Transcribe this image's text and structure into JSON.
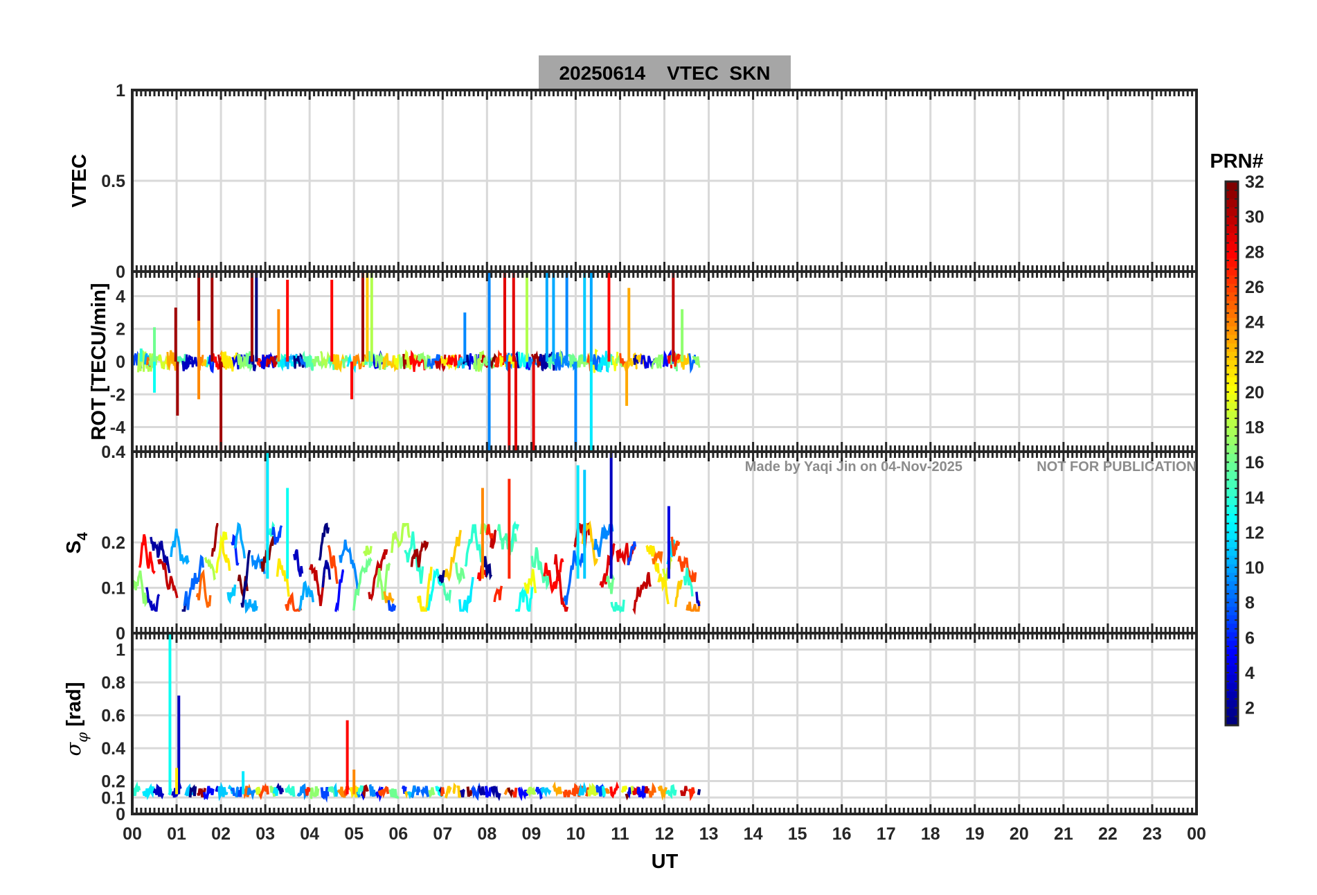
{
  "figure": {
    "title": "20250614    VTEC  SKN",
    "watermark_author": "Made by Yaqi Jin on 04-Nov-2025",
    "watermark_notice": "NOT FOR PUBLICATION",
    "x_axis_label": "UT",
    "x_ticks": [
      "00",
      "01",
      "02",
      "03",
      "04",
      "05",
      "06",
      "07",
      "08",
      "09",
      "10",
      "11",
      "12",
      "13",
      "14",
      "15",
      "16",
      "17",
      "18",
      "19",
      "20",
      "21",
      "22",
      "23",
      "00"
    ],
    "colorbar": {
      "label": "PRN#",
      "colormap": "jet",
      "range": [
        1,
        32
      ],
      "ticks": [
        "2",
        "4",
        "6",
        "8",
        "10",
        "12",
        "14",
        "16",
        "18",
        "20",
        "22",
        "24",
        "26",
        "28",
        "30",
        "32"
      ]
    },
    "colors": {
      "title_bg": "#a6a6a6",
      "grid": "#d9d9d9",
      "axes": "#262626",
      "watermark": "#8c8c8c"
    }
  },
  "chart_data": [
    {
      "type": "line",
      "panel": "vtec",
      "ylabel": "VTEC",
      "ylim": [
        0,
        1
      ],
      "yticks": [
        "1",
        "0.5",
        "0"
      ],
      "xlim": [
        0,
        24
      ],
      "series": []
    },
    {
      "type": "line",
      "panel": "rot",
      "ylabel": "ROT [TECU/min]",
      "ylim": [
        -5.5,
        5.5
      ],
      "yticks": [
        "4",
        "2",
        "0",
        "-2",
        "-4"
      ],
      "xlim": [
        0,
        24
      ],
      "data_span_hours": [
        0,
        12.8
      ],
      "spikes": [
        {
          "x": 0.2,
          "y": 0.8,
          "prn": 14
        },
        {
          "x": 0.5,
          "y": 2.1,
          "prn": 16
        },
        {
          "x": 0.5,
          "y": -1.9,
          "prn": 13
        },
        {
          "x": 0.98,
          "y": 3.3,
          "prn": 31
        },
        {
          "x": 1.02,
          "y": -3.3,
          "prn": 31
        },
        {
          "x": 1.5,
          "y": 5.5,
          "prn": 31
        },
        {
          "x": 1.5,
          "y": 2.5,
          "prn": 24
        },
        {
          "x": 1.5,
          "y": -2.3,
          "prn": 24
        },
        {
          "x": 1.8,
          "y": 5.5,
          "prn": 31
        },
        {
          "x": 2.0,
          "y": -5.5,
          "prn": 31
        },
        {
          "x": 2.7,
          "y": 5.5,
          "prn": 31
        },
        {
          "x": 2.8,
          "y": 5.5,
          "prn": 1
        },
        {
          "x": 3.3,
          "y": 3.2,
          "prn": 24
        },
        {
          "x": 3.5,
          "y": 5.0,
          "prn": 28
        },
        {
          "x": 4.5,
          "y": 5.0,
          "prn": 28
        },
        {
          "x": 4.95,
          "y": -2.3,
          "prn": 28
        },
        {
          "x": 5.2,
          "y": 5.5,
          "prn": 31
        },
        {
          "x": 5.3,
          "y": 5.5,
          "prn": 22
        },
        {
          "x": 5.4,
          "y": 5.5,
          "prn": 18
        },
        {
          "x": 7.5,
          "y": 3.0,
          "prn": 9
        },
        {
          "x": 8.05,
          "y": 5.5,
          "prn": 9
        },
        {
          "x": 8.05,
          "y": -5.5,
          "prn": 9
        },
        {
          "x": 8.4,
          "y": 5.5,
          "prn": 29
        },
        {
          "x": 8.5,
          "y": -5.5,
          "prn": 29
        },
        {
          "x": 8.6,
          "y": 5.5,
          "prn": 29
        },
        {
          "x": 8.65,
          "y": -5.5,
          "prn": 29
        },
        {
          "x": 8.9,
          "y": 5.5,
          "prn": 18
        },
        {
          "x": 9.05,
          "y": -5.5,
          "prn": 29
        },
        {
          "x": 9.35,
          "y": 5.5,
          "prn": 10
        },
        {
          "x": 9.5,
          "y": 5.5,
          "prn": 10
        },
        {
          "x": 9.8,
          "y": 5.5,
          "prn": 9
        },
        {
          "x": 10.0,
          "y": -5.5,
          "prn": 9
        },
        {
          "x": 10.2,
          "y": 5.5,
          "prn": 11
        },
        {
          "x": 10.35,
          "y": 5.5,
          "prn": 10
        },
        {
          "x": 10.35,
          "y": -5.5,
          "prn": 12
        },
        {
          "x": 10.75,
          "y": 5.5,
          "prn": 28
        },
        {
          "x": 11.15,
          "y": -2.7,
          "prn": 23
        },
        {
          "x": 11.2,
          "y": 4.5,
          "prn": 23
        },
        {
          "x": 12.2,
          "y": 5.5,
          "prn": 30
        },
        {
          "x": 12.4,
          "y": 3.2,
          "prn": 17
        }
      ]
    },
    {
      "type": "line",
      "panel": "s4",
      "ylabel": "S4",
      "ylim": [
        0,
        0.4
      ],
      "yticks": [
        "0.4",
        "0.2",
        "0.1",
        "0"
      ],
      "xlim": [
        0,
        24
      ],
      "data_span_hours": [
        0,
        12.8
      ],
      "typical_range": [
        0.05,
        0.22
      ],
      "peaks": [
        {
          "x": 3.05,
          "y": 0.4,
          "prn": 12
        },
        {
          "x": 3.5,
          "y": 0.32,
          "prn": 13
        },
        {
          "x": 7.9,
          "y": 0.32,
          "prn": 24
        },
        {
          "x": 8.5,
          "y": 0.34,
          "prn": 27
        },
        {
          "x": 10.05,
          "y": 0.37,
          "prn": 12
        },
        {
          "x": 10.2,
          "y": 0.36,
          "prn": 11
        },
        {
          "x": 10.8,
          "y": 0.4,
          "prn": 3
        },
        {
          "x": 12.1,
          "y": 0.28,
          "prn": 4
        }
      ]
    },
    {
      "type": "line",
      "panel": "sigma_phi",
      "ylabel": "σ_φ [rad]",
      "ylim": [
        0,
        1.1
      ],
      "yticks": [
        "1",
        "0.8",
        "0.6",
        "0.4",
        "0.2",
        "0.1",
        "0"
      ],
      "xlim": [
        0,
        24
      ],
      "data_span_hours": [
        0,
        12.8
      ],
      "typical_range": [
        0.09,
        0.18
      ],
      "peaks": [
        {
          "x": 0.85,
          "y": 1.1,
          "prn": 13
        },
        {
          "x": 1.05,
          "y": 0.72,
          "prn": 3
        },
        {
          "x": 4.85,
          "y": 0.57,
          "prn": 28
        },
        {
          "x": 1.0,
          "y": 0.28,
          "prn": 21
        },
        {
          "x": 5.0,
          "y": 0.27,
          "prn": 24
        },
        {
          "x": 2.5,
          "y": 0.26,
          "prn": 12
        }
      ]
    }
  ]
}
